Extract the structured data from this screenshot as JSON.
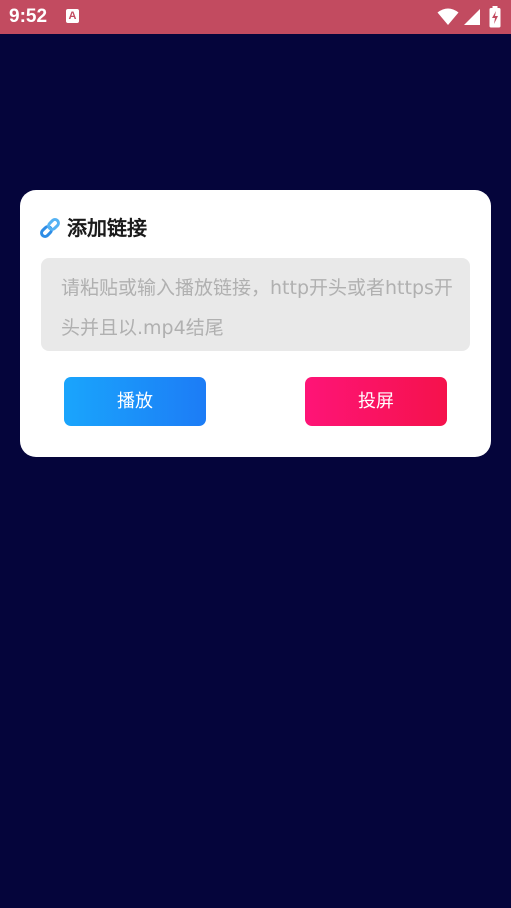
{
  "status_bar": {
    "time": "9:52",
    "notification_icon_letter": "A",
    "icons": [
      "a-notification-icon",
      "wifi-icon",
      "signal-icon",
      "battery-charging-icon"
    ],
    "background_color": "#c24b60"
  },
  "screen": {
    "background_color": "#05053b"
  },
  "dialog": {
    "icon": "link-icon",
    "title": "添加链接",
    "input": {
      "value": "",
      "placeholder": "请粘贴或输入播放链接，http开头或者https开头并且以.mp4结尾"
    },
    "buttons": {
      "play_label": "播放",
      "play_color": "#1a8ffa",
      "cast_label": "投屏",
      "cast_color": "#fb1462"
    }
  }
}
